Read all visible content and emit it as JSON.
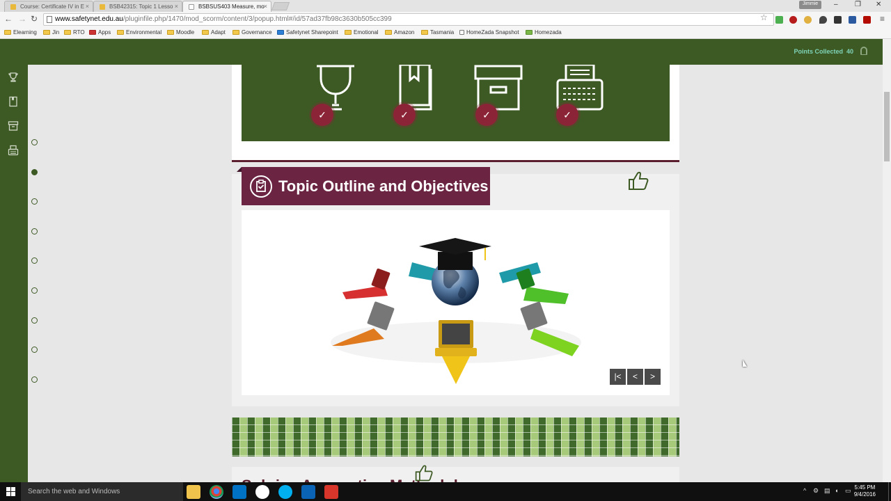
{
  "browser": {
    "tabs": [
      {
        "title": "Course: Certificate IV in E",
        "active": false
      },
      {
        "title": "BSB42315: Topic 1 Lesso",
        "active": false
      },
      {
        "title": "BSBSUS403 Measure, mo",
        "active": true
      }
    ],
    "user_chip": "Jimmie",
    "url_host": "www.safetynet.edu.au",
    "url_rest": "/pluginfile.php/1470/mod_scorm/content/3/popup.html#/id/57ad37fb98c3630b505cc399",
    "bookmarks": [
      "Elearning",
      "Jin",
      "RTO",
      "Apps",
      "Environmental",
      "Moodle",
      "Adapt",
      "Governance",
      "Safetynet Sharepoint",
      "Emotional",
      "Amazon",
      "Tasmania",
      "HomeZada Snapshot",
      "Homezada"
    ]
  },
  "page": {
    "points_label": "Points Collected",
    "points_value": "40",
    "section_title": "Topic Outline and Objectives",
    "next_section_title": "Sub-ins Accounting Methodology",
    "nav_dot_count": 9,
    "active_dot_index": 1,
    "badge_icons": [
      "trophy-icon",
      "book-icon",
      "archive-box-icon",
      "typewriter-icon"
    ],
    "slide_nav": {
      "first": "|<",
      "prev": "<",
      "next": ">"
    }
  },
  "taskbar": {
    "search_placeholder": "Search the web and Windows",
    "time": "5:45 PM",
    "date": "9/4/2016"
  },
  "colors": {
    "brand_green": "#3d5a24",
    "banner_maroon": "#6b2543",
    "check_badge": "#8b2436",
    "points_text": "#7fd3b9"
  }
}
